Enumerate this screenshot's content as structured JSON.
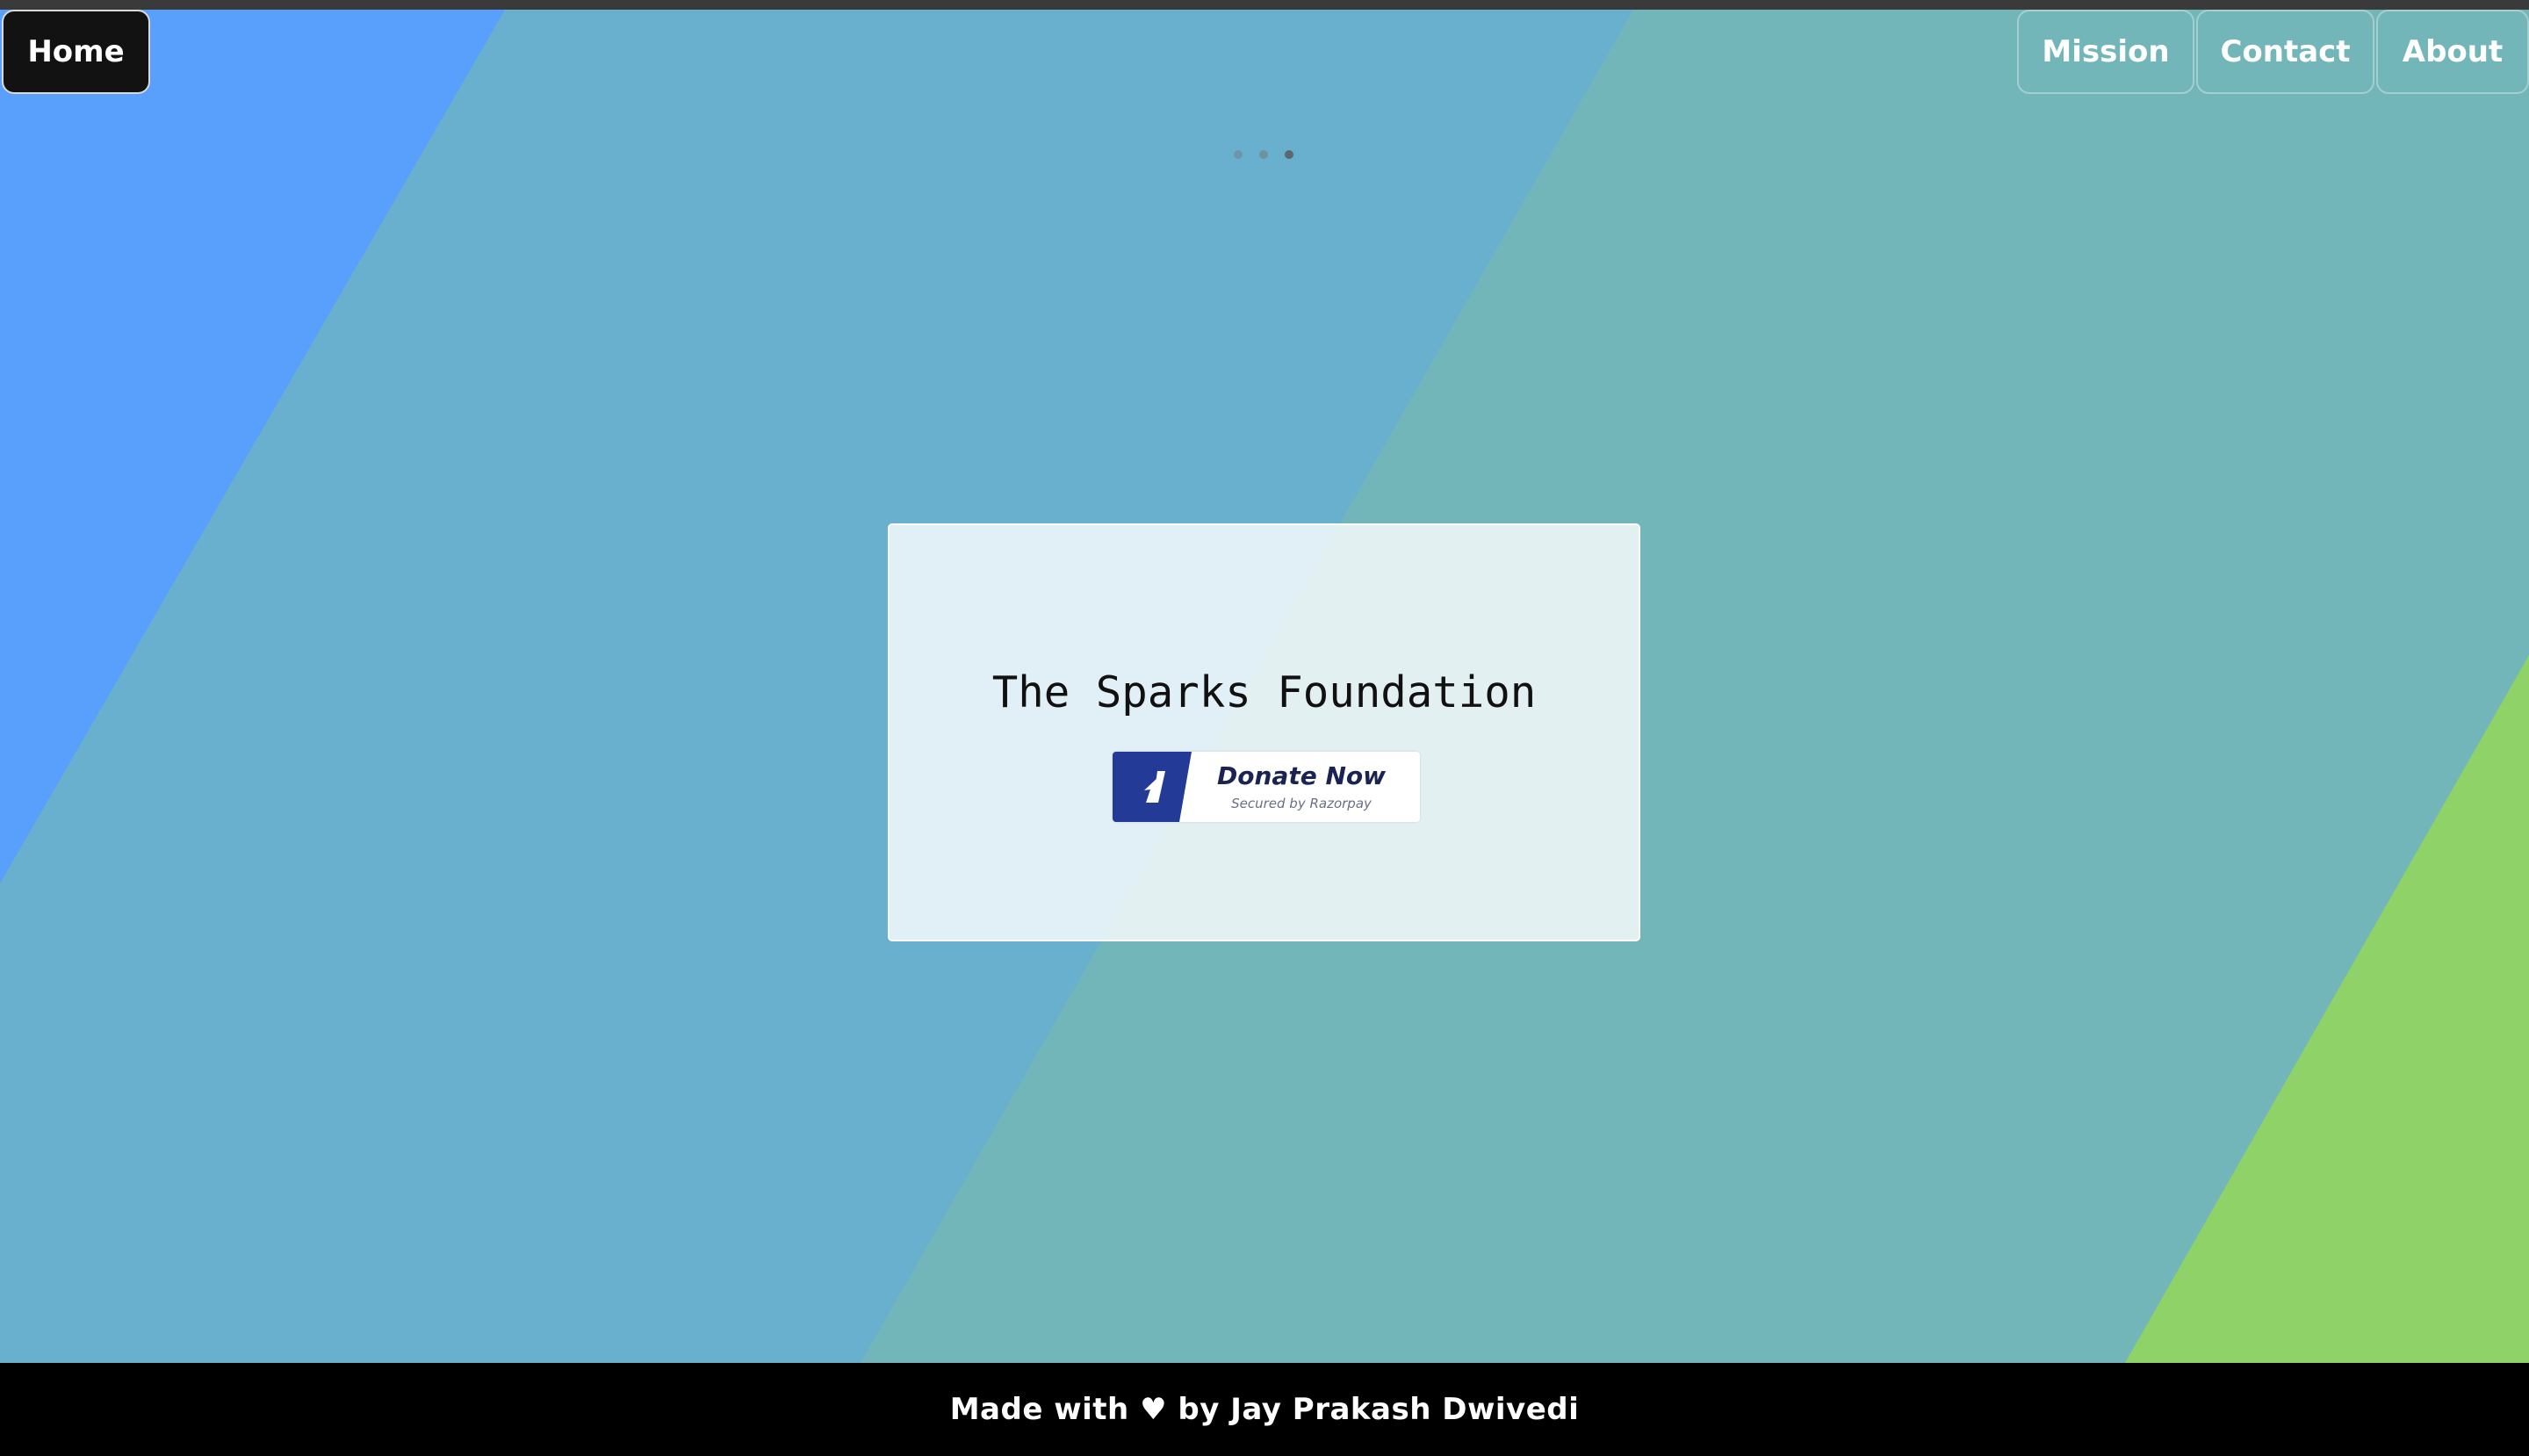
{
  "nav": {
    "home_label": "Home",
    "mission_label": "Mission",
    "contact_label": "Contact",
    "about_label": "About"
  },
  "carousel": {
    "slide_count": 3,
    "active_index": 2
  },
  "card": {
    "title": "The Sparks Foundation"
  },
  "donate_button": {
    "label": "Donate Now",
    "sublabel": "Secured by Razorpay",
    "icon": "razorpay-logo-icon"
  },
  "footer": {
    "text": "Made with ♥ by Jay Prakash Dwivedi"
  },
  "colors": {
    "band_blue": "#58a0fb",
    "band_mid_blue": "#69b0cf",
    "band_teal": "#72b6b9",
    "band_green": "#8fd267",
    "home_bg": "#121212",
    "footer_bg": "#000000",
    "razorpay_blue": "#233b96"
  }
}
